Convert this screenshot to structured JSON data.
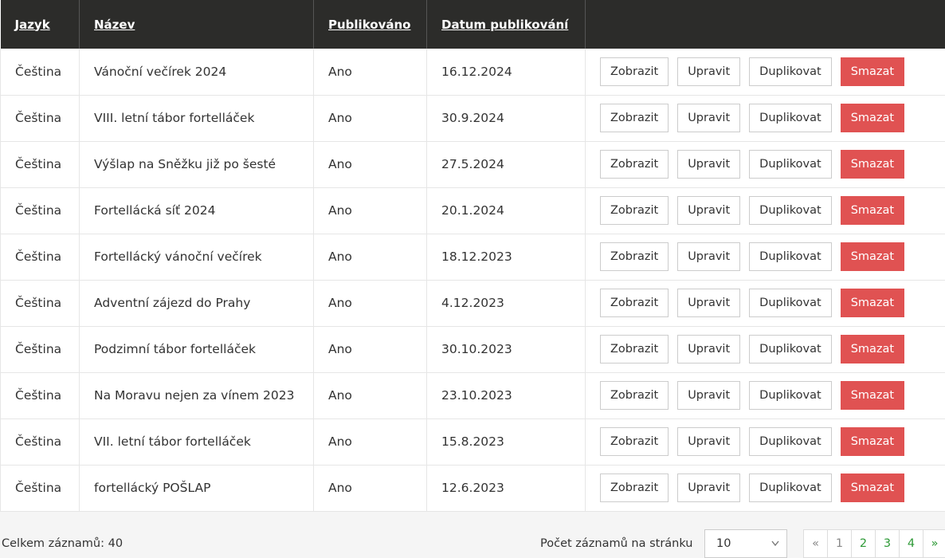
{
  "table": {
    "headers": [
      "Jazyk",
      "Název",
      "Publikováno",
      "Datum publikování"
    ],
    "action_labels": {
      "view": "Zobrazit",
      "edit": "Upravit",
      "duplicate": "Duplikovat",
      "delete": "Smazat"
    },
    "rows": [
      {
        "lang": "Čeština",
        "name": "Vánoční večírek 2024",
        "published": "Ano",
        "date": "16.12.2024"
      },
      {
        "lang": "Čeština",
        "name": "VIII. letní tábor fortelláček",
        "published": "Ano",
        "date": "30.9.2024"
      },
      {
        "lang": "Čeština",
        "name": "Výšlap na Sněžku již po šesté",
        "published": "Ano",
        "date": "27.5.2024"
      },
      {
        "lang": "Čeština",
        "name": "Fortellácká síť 2024",
        "published": "Ano",
        "date": "20.1.2024"
      },
      {
        "lang": "Čeština",
        "name": "Fortellácký vánoční večírek",
        "published": "Ano",
        "date": "18.12.2023"
      },
      {
        "lang": "Čeština",
        "name": "Adventní zájezd do Prahy",
        "published": "Ano",
        "date": "4.12.2023"
      },
      {
        "lang": "Čeština",
        "name": "Podzimní tábor fortelláček",
        "published": "Ano",
        "date": "30.10.2023"
      },
      {
        "lang": "Čeština",
        "name": "Na Moravu nejen za vínem 2023",
        "published": "Ano",
        "date": "23.10.2023"
      },
      {
        "lang": "Čeština",
        "name": "VII. letní tábor fortelláček",
        "published": "Ano",
        "date": "15.8.2023"
      },
      {
        "lang": "Čeština",
        "name": "fortellácký POŠLAP",
        "published": "Ano",
        "date": "12.6.2023"
      }
    ]
  },
  "footer": {
    "total": "Celkem záznamů: 40",
    "per_page_label": "Počet záznamů na stránku",
    "per_page_value": "10",
    "pager": [
      "«",
      "1",
      "2",
      "3",
      "4",
      "»"
    ]
  },
  "colors": {
    "header_bg": "#2c2c2a",
    "danger": "#e05252",
    "link": "#2e9a37"
  },
  "icons": {
    "select": "chevron-down-icon"
  }
}
